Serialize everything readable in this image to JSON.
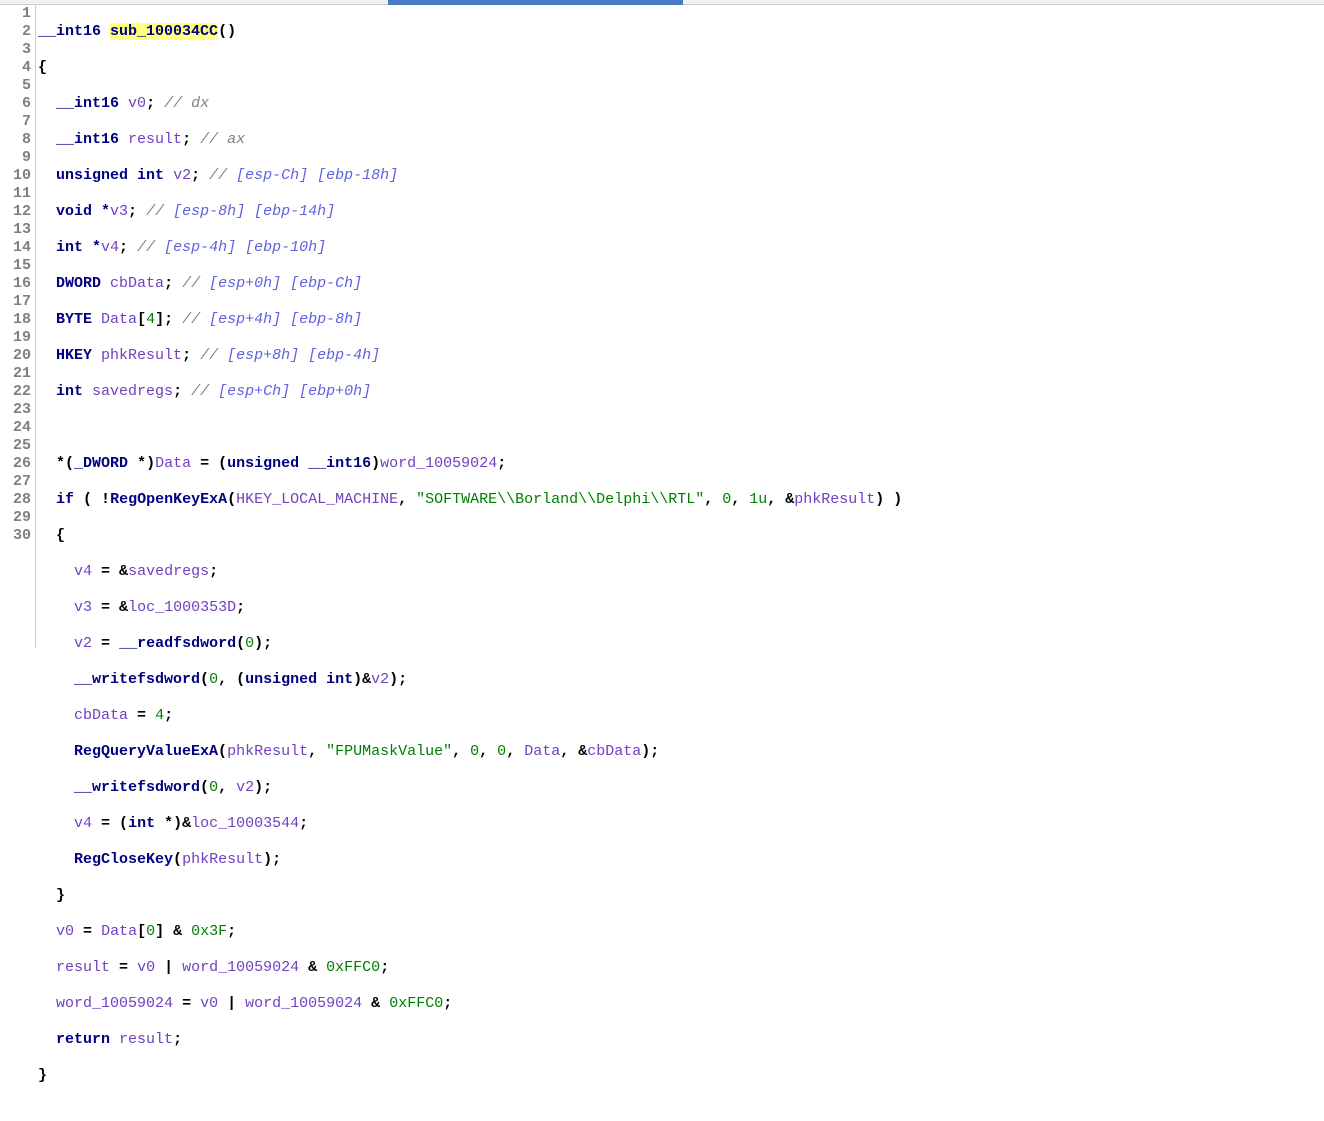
{
  "lineCount": 30,
  "code": {
    "funcName": "sub_100034CC",
    "retType": "__int16",
    "decl": {
      "v0": {
        "type": "__int16",
        "name": "v0",
        "comment": "// dx"
      },
      "result": {
        "type": "__int16",
        "name": "result",
        "comment": "// ax"
      },
      "v2": {
        "type": "unsigned int",
        "name": "v2",
        "comment_gray": "// ",
        "comment_blue": "[esp-Ch] [ebp-18h]"
      },
      "v3": {
        "type": "void *",
        "name": "v3",
        "comment_gray": "// ",
        "comment_blue": "[esp-8h] [ebp-14h]"
      },
      "v4": {
        "type": "int *",
        "name": "v4",
        "comment_gray": "// ",
        "comment_blue": "[esp-4h] [ebp-10h]"
      },
      "cbData": {
        "type": "DWORD",
        "name": "cbData",
        "comment_gray": "// ",
        "comment_blue": "[esp+0h] [ebp-Ch]"
      },
      "Data": {
        "type": "BYTE",
        "name": "Data",
        "size": "4",
        "comment_gray": "// ",
        "comment_blue": "[esp+4h] [ebp-8h]"
      },
      "phkResult": {
        "type": "HKEY",
        "name": "phkResult",
        "comment_gray": "// ",
        "comment_blue": "[esp+8h] [ebp-4h]"
      },
      "savedregs": {
        "type": "int",
        "name": "savedregs",
        "comment_gray": "// ",
        "comment_blue": "[esp+Ch] [ebp+0h]"
      }
    },
    "stmt": {
      "cast": "_DWORD",
      "dataVar": "Data",
      "assignCast": "(unsigned __int16)",
      "word": "word_10059024",
      "regOpen": "RegOpenKeyExA",
      "hkey": "HKEY_LOCAL_MACHINE",
      "regPath": "\"SOFTWARE\\\\Borland\\\\Delphi\\\\RTL\"",
      "zero": "0",
      "one": "1u",
      "phk": "phkResult",
      "loc1": "loc_1000353D",
      "readfs": "__readfsdword",
      "writefs": "__writefsdword",
      "cbVal": "4",
      "regQuery": "RegQueryValueExA",
      "fpuMask": "\"FPUMaskValue\"",
      "loc2": "loc_10003544",
      "regClose": "RegCloseKey",
      "mask1": "0x3F",
      "mask2": "0xFFC0"
    }
  }
}
